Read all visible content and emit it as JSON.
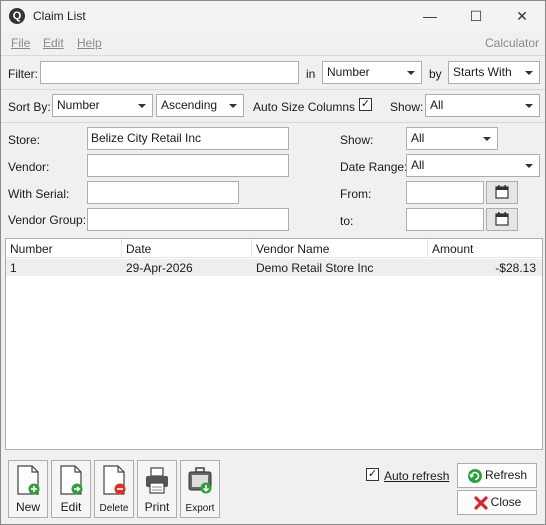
{
  "window": {
    "title": "Claim List",
    "controls": {
      "minimize": "—",
      "maximize": "☐",
      "close": "✕"
    }
  },
  "menu": {
    "file": "File",
    "edit": "Edit",
    "help": "Help",
    "calculator": "Calculator"
  },
  "filter": {
    "label": "Filter:",
    "value": "",
    "in_label": "in",
    "in_value": "Number",
    "by_label": "by",
    "by_value": "Starts With"
  },
  "sort": {
    "label": "Sort By:",
    "field": "Number",
    "direction": "Ascending",
    "auto_size_label": "Auto Size Columns",
    "auto_size_checked": "✓",
    "show_label": "Show:",
    "show_value": "All"
  },
  "fields": {
    "store_label": "Store:",
    "store_value": "Belize City Retail Inc",
    "vendor_label": "Vendor:",
    "vendor_value": "",
    "serial_label": "With Serial:",
    "serial_value": "",
    "vendor_group_label": "Vendor Group:",
    "vendor_group_value": "",
    "show_label": "Show:",
    "show_value": "All",
    "date_range_label": "Date Range:",
    "date_range_value": "All",
    "from_label": "From:",
    "from_value": "",
    "to_label": "to:",
    "to_value": ""
  },
  "table": {
    "columns": [
      "Number",
      "Date",
      "Vendor Name",
      "Amount"
    ],
    "rows": [
      {
        "number": "1",
        "date": "29-Apr-2026",
        "vendor": "Demo Retail Store Inc",
        "amount": "-$28.13"
      }
    ]
  },
  "toolbar": {
    "new": "New",
    "edit": "Edit",
    "delete": "Delete",
    "print": "Print",
    "export": "Export"
  },
  "footer": {
    "auto_refresh_label": "Auto refresh",
    "auto_refresh_checked": "✓",
    "refresh": "Refresh",
    "close": "Close"
  },
  "colors": {
    "accent_green": "#2e9e3e",
    "delete_red": "#d9302c",
    "close_red": "#d62828"
  }
}
